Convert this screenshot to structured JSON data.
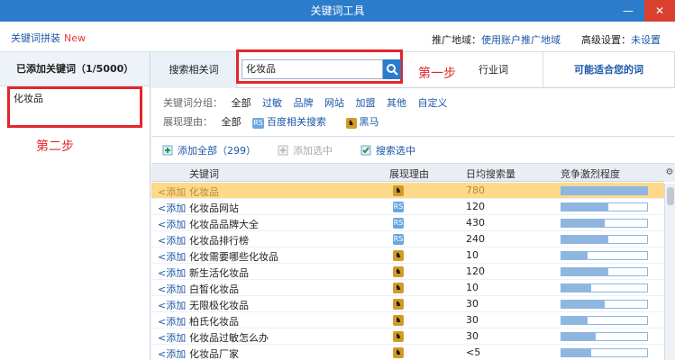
{
  "window": {
    "title": "关键词工具",
    "minimize": "—",
    "close": "✕"
  },
  "topbar": {
    "brand": "关键词拼装",
    "brand_badge": "New",
    "promo_label": "推广地域：",
    "promo_link": "使用账户推广地域",
    "adv_label": "高级设置：",
    "adv_value": "未设置"
  },
  "left": {
    "title": "已添加关键词（1/5000）",
    "keyword": "化妆品",
    "annotation": "第二步"
  },
  "tabs": {
    "search_related": "搜索相关词",
    "search_value": "化妆品",
    "step_note": "第一步",
    "industry": "行业词",
    "suggest": "可能适合您的词"
  },
  "filters": {
    "group_label": "关键词分组：",
    "group_all": "全部",
    "groups": [
      "过敏",
      "品牌",
      "网站",
      "加盟",
      "其他",
      "自定义"
    ],
    "reason_label": "展现理由：",
    "reason_all": "全部",
    "reason_rs": "百度相关搜索",
    "reason_hm": "黑马"
  },
  "actions": {
    "add_all": "添加全部（299）",
    "add_selected": "添加选中",
    "search_selected": "搜索选中"
  },
  "grid": {
    "headers": {
      "keyword": "关键词",
      "reason": "展现理由",
      "volume": "日均搜索量",
      "competition": "竞争激烈程度"
    },
    "add_label": "<添加",
    "rows": [
      {
        "kw": "化妆品",
        "reason": "hm",
        "vol": "780",
        "comp": 1.0,
        "hl": true
      },
      {
        "kw": "化妆品网站",
        "reason": "rs",
        "vol": "120",
        "comp": 0.55
      },
      {
        "kw": "化妆品品牌大全",
        "reason": "rs",
        "vol": "430",
        "comp": 0.5
      },
      {
        "kw": "化妆品排行榜",
        "reason": "rs",
        "vol": "240",
        "comp": 0.55
      },
      {
        "kw": "化妆需要哪些化妆品",
        "reason": "hm",
        "vol": "10",
        "comp": 0.3
      },
      {
        "kw": "新生活化妆品",
        "reason": "hm",
        "vol": "120",
        "comp": 0.55
      },
      {
        "kw": "白皙化妆品",
        "reason": "hm",
        "vol": "10",
        "comp": 0.35
      },
      {
        "kw": "无限极化妆品",
        "reason": "hm",
        "vol": "30",
        "comp": 0.5
      },
      {
        "kw": "柏氏化妆品",
        "reason": "hm",
        "vol": "30",
        "comp": 0.3
      },
      {
        "kw": "化妆品过敏怎么办",
        "reason": "hm",
        "vol": "30",
        "comp": 0.4
      },
      {
        "kw": "化妆品厂家",
        "reason": "hm",
        "vol": "<5",
        "comp": 0.35
      }
    ],
    "rs_tag": "RS",
    "hm_tag": "♞"
  }
}
